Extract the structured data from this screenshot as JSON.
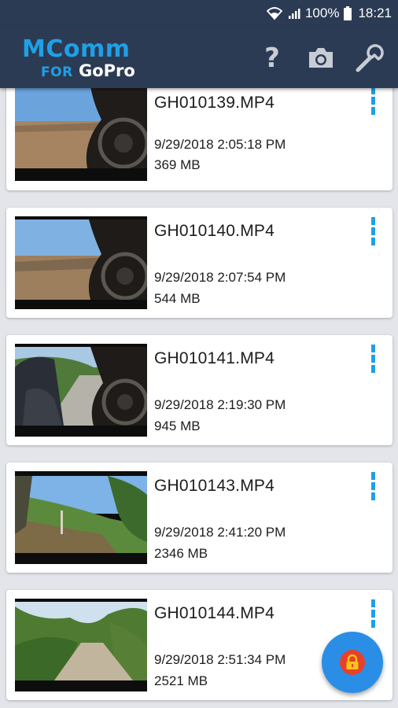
{
  "status_bar": {
    "wifi_icon": "wifi-icon",
    "signal_icon": "signal-icon",
    "battery_percent": "100%",
    "battery_icon": "battery-icon",
    "time": "18:21"
  },
  "app_bar": {
    "logo_main": "MComm",
    "logo_for": "FOR",
    "logo_brand": "GoPro",
    "actions": [
      {
        "icon": "help-icon",
        "glyph": "?"
      },
      {
        "icon": "camera-icon"
      },
      {
        "icon": "wrench-icon"
      }
    ]
  },
  "colors": {
    "app_bar": "#2c3b54",
    "accent": "#1ea0e8",
    "fab": "#2a8ee6",
    "fab_inner": "#e8402a",
    "lock": "#f5c518",
    "background": "#e3e5ea"
  },
  "videos": [
    {
      "name": "GH010139.MP4",
      "date": "9/29/2018 2:05:18 PM",
      "size": "369 MB"
    },
    {
      "name": "GH010140.MP4",
      "date": "9/29/2018 2:07:54 PM",
      "size": "544 MB"
    },
    {
      "name": "GH010141.MP4",
      "date": "9/29/2018 2:19:30 PM",
      "size": "945 MB"
    },
    {
      "name": "GH010143.MP4",
      "date": "9/29/2018 2:41:20 PM",
      "size": "2346 MB"
    },
    {
      "name": "GH010144.MP4",
      "date": "9/29/2018 2:51:34 PM",
      "size": "2521 MB"
    }
  ],
  "fab": {
    "icon": "lock-icon"
  }
}
